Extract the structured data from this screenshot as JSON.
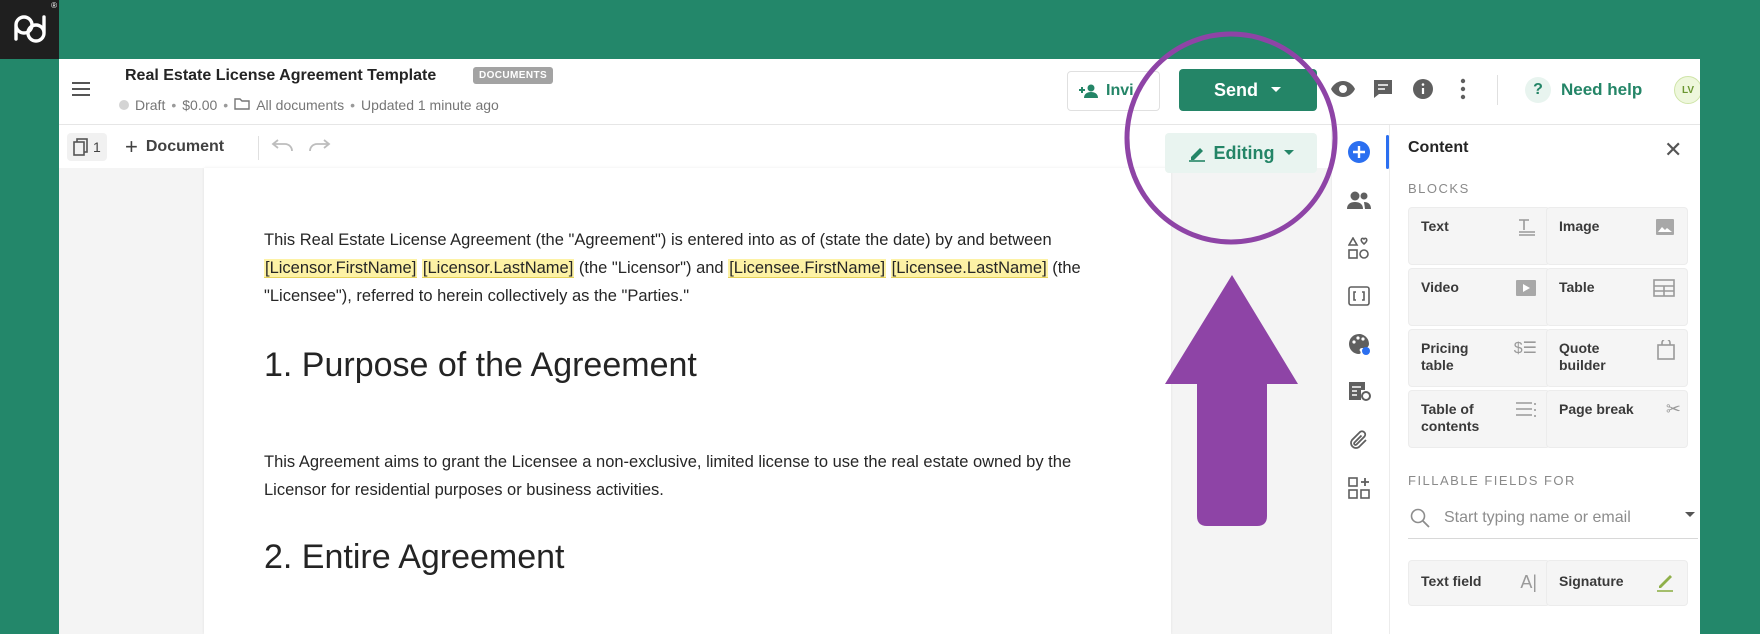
{
  "brand": {
    "logo": "pd",
    "reg_mark": "®"
  },
  "header": {
    "doc_title": "Real Estate License Agreement Template",
    "doc_badge": "DOCUMENTS",
    "status": "Draft",
    "price": "$0.00",
    "folder": "All documents",
    "updated": "Updated 1 minute ago",
    "sep": "•",
    "invite_label": "Invi",
    "send_label": "Send",
    "help_label": "Need help",
    "help_glyph": "?",
    "avatar_initials": "LV"
  },
  "toolbar": {
    "page_count": "1",
    "add_document_label": "Document",
    "add_glyph": "+",
    "editing_label": "Editing"
  },
  "document": {
    "p1_a": "This Real Estate License Agreement (the \"Agreement\") is entered into as of (state the date) by and between ",
    "var_licensor_first": "[Licensor.FirstName]",
    "var_licensor_last": "[Licensor.LastName]",
    "p1_b": " (the \"Licensor\") and ",
    "var_licensee_first": "[Licensee.FirstName]",
    "var_licensee_last": "[Licensee.LastName]",
    "p1_c": " (the \"Licensee\"), referred to herein collectively as the \"Parties.\"",
    "heading_1": "1. Purpose of the Agreement",
    "p2": "This Agreement aims to grant the Licensee a non-exclusive, limited license to use the real estate owned by the Licensor for residential purposes or business activities.",
    "heading_2": "2. Entire Agreement"
  },
  "panel": {
    "title": "Content",
    "close_glyph": "✕",
    "blocks_label": "BLOCKS",
    "blocks": [
      {
        "label": "Text",
        "icon": "text-icon"
      },
      {
        "label": "Image",
        "icon": "image-icon"
      },
      {
        "label": "Video",
        "icon": "video-icon"
      },
      {
        "label": "Table",
        "icon": "table-icon"
      },
      {
        "label": "Pricing table",
        "icon": "pricing-table-icon",
        "glyph": "$☰"
      },
      {
        "label": "Quote builder",
        "icon": "quote-builder-icon"
      },
      {
        "label": "Table of contents",
        "icon": "list-icon"
      },
      {
        "label": "Page break",
        "icon": "scissors-icon",
        "glyph": "✂"
      }
    ],
    "fillable_label": "FILLABLE FIELDS FOR",
    "search_placeholder": "Start typing name or email",
    "fields": [
      {
        "label": "Text field",
        "icon": "text-field-icon",
        "glyph": "A|"
      },
      {
        "label": "Signature",
        "icon": "pen-icon"
      }
    ]
  },
  "colors": {
    "brand_green": "#23876a",
    "send_green": "#248567",
    "annotation_purple": "#8e44a6",
    "variable_highlight": "#fdf2a5"
  }
}
